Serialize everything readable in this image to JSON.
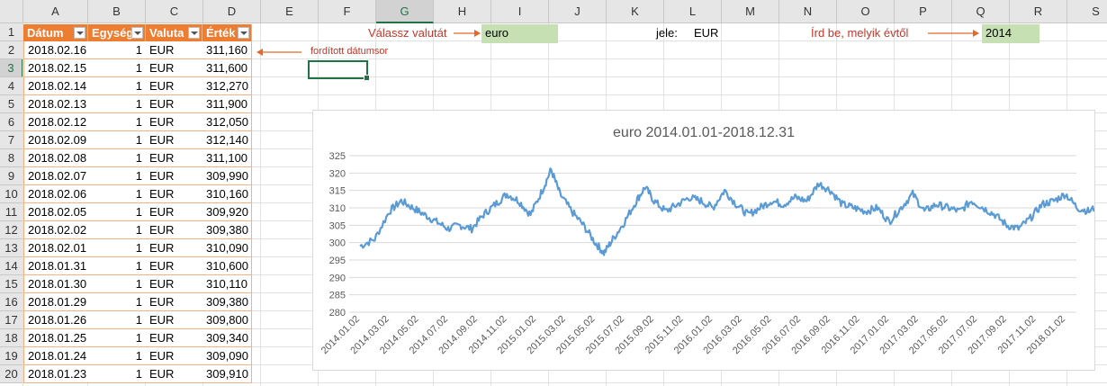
{
  "columns": [
    "A",
    "B",
    "C",
    "D",
    "E",
    "F",
    "G",
    "H",
    "I",
    "J",
    "K",
    "L",
    "M",
    "N",
    "O",
    "P",
    "Q",
    "R",
    "S"
  ],
  "rows": [
    "1",
    "2",
    "3",
    "4",
    "5",
    "6",
    "7",
    "8",
    "9",
    "10",
    "11",
    "12",
    "13",
    "14",
    "15",
    "16",
    "17",
    "18",
    "19",
    "20"
  ],
  "table": {
    "headers": [
      "Dátum",
      "Egység",
      "Valuta",
      "Érték"
    ],
    "rows": [
      [
        "2018.02.16",
        "1",
        "EUR",
        "311,160"
      ],
      [
        "2018.02.15",
        "1",
        "EUR",
        "311,600"
      ],
      [
        "2018.02.14",
        "1",
        "EUR",
        "312,270"
      ],
      [
        "2018.02.13",
        "1",
        "EUR",
        "311,900"
      ],
      [
        "2018.02.12",
        "1",
        "EUR",
        "312,050"
      ],
      [
        "2018.02.09",
        "1",
        "EUR",
        "312,140"
      ],
      [
        "2018.02.08",
        "1",
        "EUR",
        "311,100"
      ],
      [
        "2018.02.07",
        "1",
        "EUR",
        "309,990"
      ],
      [
        "2018.02.06",
        "1",
        "EUR",
        "310,160"
      ],
      [
        "2018.02.05",
        "1",
        "EUR",
        "309,920"
      ],
      [
        "2018.02.02",
        "1",
        "EUR",
        "309,380"
      ],
      [
        "2018.02.01",
        "1",
        "EUR",
        "310,090"
      ],
      [
        "2018.01.31",
        "1",
        "EUR",
        "310,600"
      ],
      [
        "2018.01.30",
        "1",
        "EUR",
        "310,110"
      ],
      [
        "2018.01.29",
        "1",
        "EUR",
        "309,380"
      ],
      [
        "2018.01.26",
        "1",
        "EUR",
        "309,800"
      ],
      [
        "2018.01.25",
        "1",
        "EUR",
        "309,340"
      ],
      [
        "2018.01.24",
        "1",
        "EUR",
        "309,090"
      ],
      [
        "2018.01.23",
        "1",
        "EUR",
        "309,910"
      ]
    ]
  },
  "controls": {
    "choose_currency_label": "Válassz valutát",
    "currency_value": "euro",
    "symbol_label": "jele:",
    "symbol_value": "EUR",
    "year_label": "Írd be, melyik évtől",
    "year_value": "2014",
    "reversed_note": "fordított dátumsor"
  },
  "colors": {
    "header_orange": "#ed7d31",
    "input_green": "#c6e0b4",
    "line_blue": "#5b9bd5",
    "note_red": "#c0392b",
    "excel_green": "#217346"
  },
  "chart_data": {
    "type": "line",
    "title": "euro 2014.01.01-2018.12.31",
    "ylim": [
      280,
      325
    ],
    "yticks": [
      280,
      285,
      290,
      295,
      300,
      305,
      310,
      315,
      320,
      325
    ],
    "xticks": [
      "2014.01.02",
      "2014.03.02",
      "2014.05.02",
      "2014.07.02",
      "2014.09.02",
      "2014.11.02",
      "2015.01.02",
      "2015.03.02",
      "2015.05.02",
      "2015.07.02",
      "2015.09.02",
      "2015.11.02",
      "2016.01.02",
      "2016.03.02",
      "2016.05.02",
      "2016.07.02",
      "2016.09.02",
      "2016.11.02",
      "2017.01.02",
      "2017.03.02",
      "2017.05.02",
      "2017.07.02",
      "2017.09.02",
      "2017.11.02",
      "2018.01.02"
    ],
    "grid": true,
    "series": [
      {
        "values": [
          [
            0,
            299
          ],
          [
            0.5,
            301
          ],
          [
            1,
            309
          ],
          [
            1.4,
            312
          ],
          [
            1.8,
            310
          ],
          [
            2.2,
            308
          ],
          [
            2.6,
            306
          ],
          [
            3.0,
            304
          ],
          [
            3.4,
            305
          ],
          [
            3.8,
            304
          ],
          [
            4.2,
            308
          ],
          [
            4.6,
            311
          ],
          [
            5.0,
            314
          ],
          [
            5.4,
            312
          ],
          [
            5.8,
            308
          ],
          [
            6.2,
            315
          ],
          [
            6.5,
            321
          ],
          [
            6.8,
            314
          ],
          [
            7.2,
            309
          ],
          [
            7.6,
            305
          ],
          [
            8.0,
            300
          ],
          [
            8.3,
            297
          ],
          [
            8.6,
            301
          ],
          [
            9.0,
            306
          ],
          [
            9.4,
            312
          ],
          [
            9.7,
            316
          ],
          [
            10.0,
            312
          ],
          [
            10.4,
            309
          ],
          [
            10.8,
            311
          ],
          [
            11.2,
            313
          ],
          [
            11.6,
            312
          ],
          [
            12.0,
            310
          ],
          [
            12.4,
            315
          ],
          [
            12.8,
            311
          ],
          [
            13.2,
            308
          ],
          [
            13.6,
            310
          ],
          [
            14.0,
            312
          ],
          [
            14.4,
            311
          ],
          [
            14.8,
            313
          ],
          [
            15.2,
            312
          ],
          [
            15.6,
            317
          ],
          [
            16.0,
            315
          ],
          [
            16.4,
            311
          ],
          [
            16.8,
            310
          ],
          [
            17.2,
            309
          ],
          [
            17.6,
            310
          ],
          [
            18.0,
            306
          ],
          [
            18.4,
            310
          ],
          [
            18.8,
            314
          ],
          [
            19.2,
            309
          ],
          [
            19.6,
            311
          ],
          [
            20.0,
            310
          ],
          [
            20.4,
            309
          ],
          [
            20.8,
            312
          ],
          [
            21.2,
            310
          ],
          [
            21.6,
            308
          ],
          [
            22.0,
            305
          ],
          [
            22.4,
            304
          ],
          [
            22.8,
            307
          ],
          [
            23.2,
            311
          ],
          [
            23.6,
            312
          ],
          [
            24.0,
            314
          ],
          [
            24.4,
            310
          ],
          [
            24.8,
            309
          ],
          [
            25.2,
            311
          ]
        ]
      }
    ]
  }
}
